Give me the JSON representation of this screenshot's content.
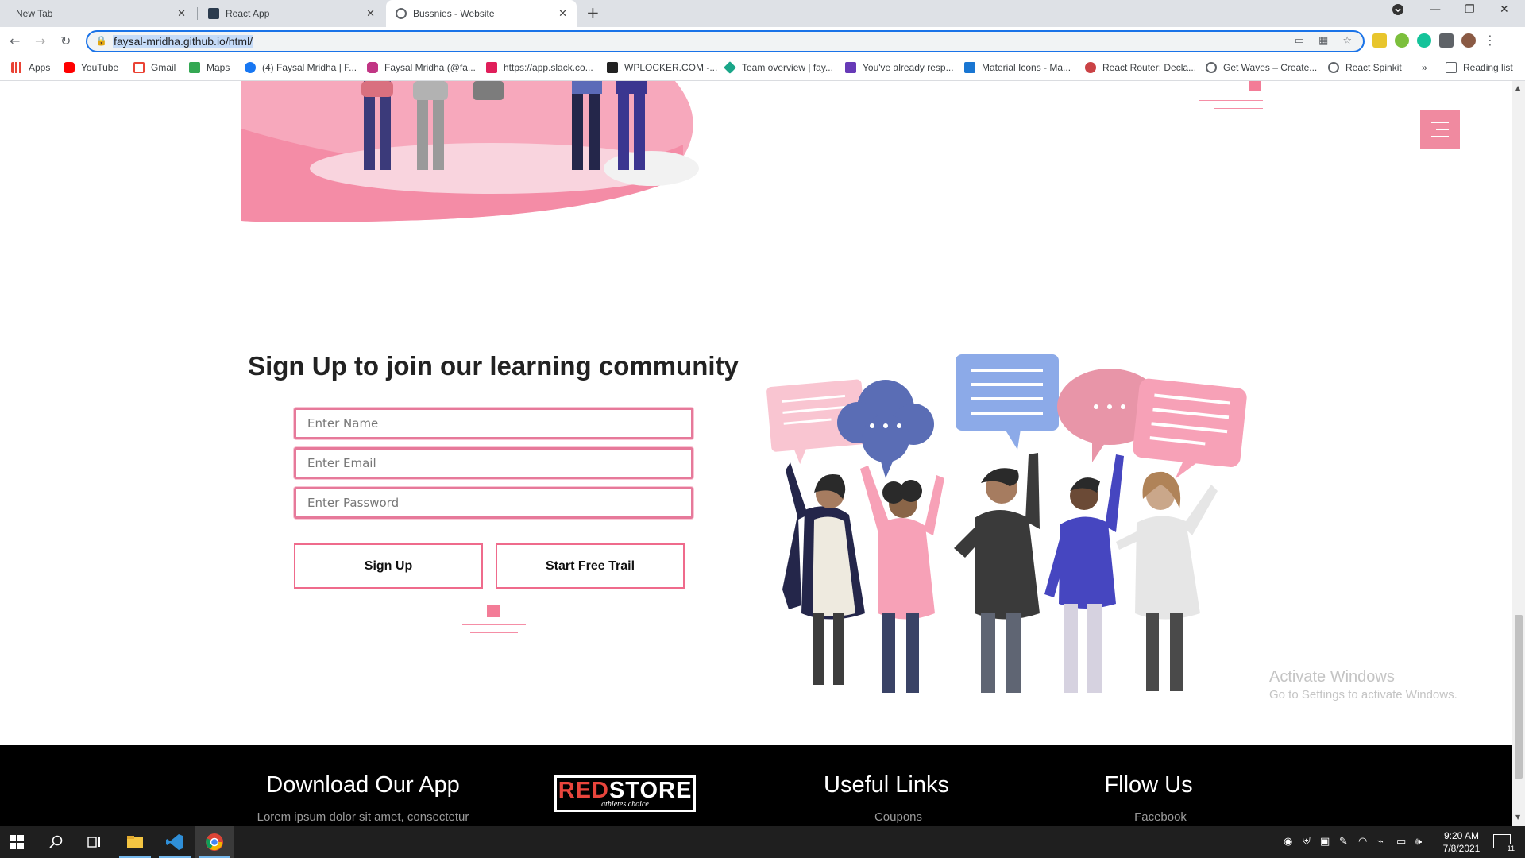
{
  "browser": {
    "tabs": [
      {
        "label": "New Tab"
      },
      {
        "label": "React App"
      },
      {
        "label": "Bussnies - Website"
      }
    ],
    "url": "faysal-mridha.github.io/html/",
    "bookmarks": [
      {
        "label": "Apps",
        "icon": "apps-grid-icon"
      },
      {
        "label": "YouTube",
        "icon": "youtube-icon"
      },
      {
        "label": "Gmail",
        "icon": "gmail-icon"
      },
      {
        "label": "Maps",
        "icon": "maps-icon"
      },
      {
        "label": "(4) Faysal Mridha | F...",
        "icon": "facebook-icon"
      },
      {
        "label": "Faysal Mridha (@fa...",
        "icon": "instagram-icon"
      },
      {
        "label": "https://app.slack.co...",
        "icon": "slack-icon"
      },
      {
        "label": "WPLOCKER.COM -...",
        "icon": "wplocker-icon"
      },
      {
        "label": "Team overview | fay...",
        "icon": "diamond-icon"
      },
      {
        "label": "You've already resp...",
        "icon": "forms-icon"
      },
      {
        "label": "Material Icons - Ma...",
        "icon": "material-icon"
      },
      {
        "label": "React Router: Decla...",
        "icon": "react-router-icon"
      },
      {
        "label": "Get Waves – Create...",
        "icon": "globe-icon"
      },
      {
        "label": "React Spinkit",
        "icon": "globe-icon"
      }
    ],
    "overflow": "»",
    "reading_list": "Reading list"
  },
  "page": {
    "heading": "Sign Up to join our learning community",
    "form": {
      "name_placeholder": "Enter Name",
      "email_placeholder": "Enter Email",
      "password_placeholder": "Enter Password",
      "signup_label": "Sign Up",
      "trial_label": "Start Free Trail"
    },
    "footer": {
      "download_title": "Download Our App",
      "download_text": "Lorem ipsum dolor sit amet, consectetur",
      "logo_red": "RED",
      "logo_white": "STORE",
      "logo_tag": "athletes choice",
      "links_title": "Useful Links",
      "links_first": "Coupons",
      "follow_title": "Fllow Us",
      "follow_first": "Facebook"
    },
    "accent_color": "#f37c97"
  },
  "watermark": {
    "line1": "Activate Windows",
    "line2": "Go to Settings to activate Windows."
  },
  "taskbar": {
    "time": "9:20 AM",
    "date": "7/8/2021",
    "notifications": "11"
  }
}
